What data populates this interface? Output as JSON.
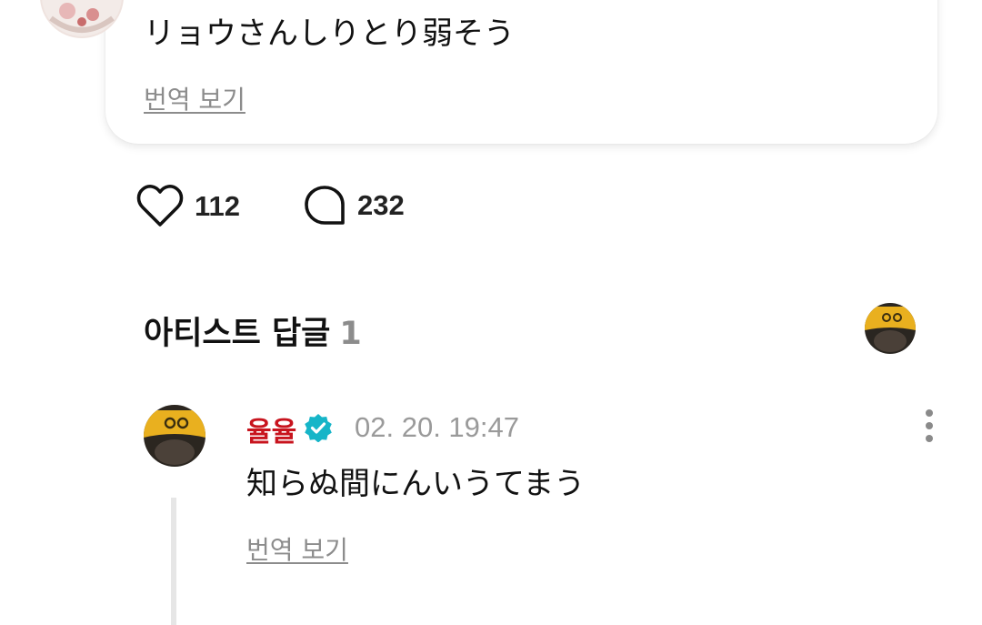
{
  "post": {
    "text": "リョウさんしりとり弱そう",
    "translate_label": "번역 보기"
  },
  "actions": {
    "likes": "112",
    "comments": "232"
  },
  "artist_replies": {
    "title": "아티스트 답글",
    "count": "1"
  },
  "reply": {
    "author": "율율",
    "timestamp": "02. 20. 19:47",
    "text": "知らぬ間にんいうてまう",
    "translate_label": "번역 보기"
  },
  "colors": {
    "author_name": "#c8141e",
    "verified_badge": "#16b5c8",
    "muted_text": "#8c8c8c"
  },
  "icons": {
    "like": "heart-outline-icon",
    "comment": "speech-bubble-icon",
    "verified": "verified-check-icon",
    "more": "vertical-dots-icon"
  }
}
